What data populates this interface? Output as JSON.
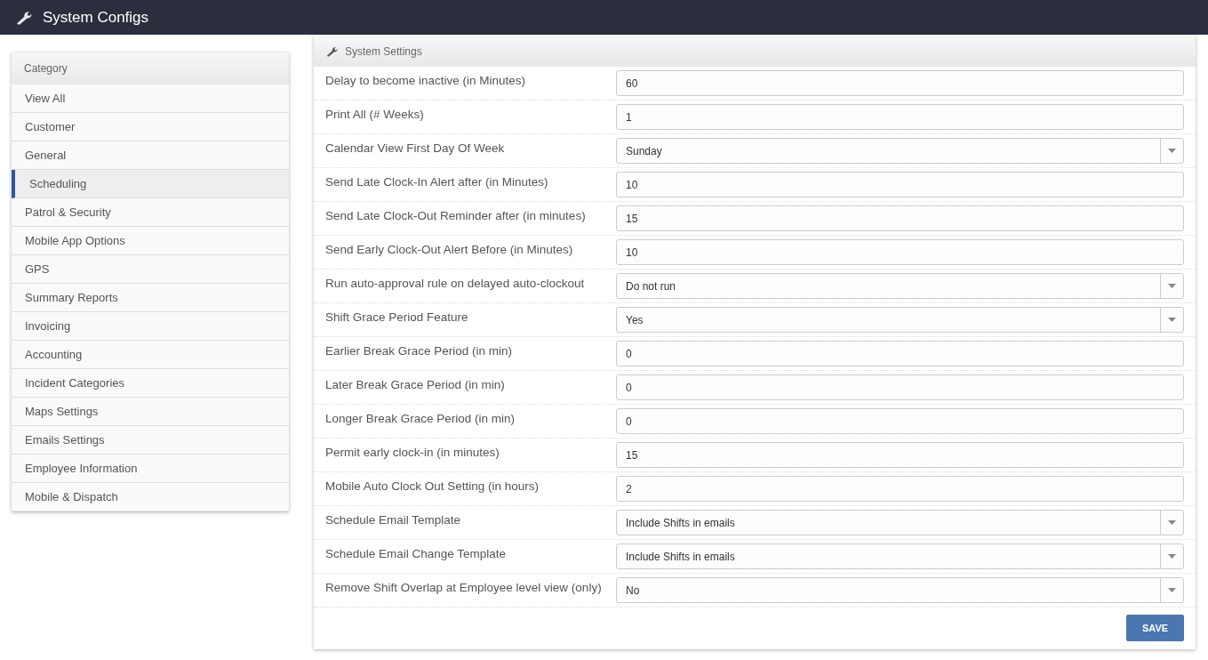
{
  "header": {
    "title": "System Configs"
  },
  "sidebar": {
    "heading": "Category",
    "items": [
      {
        "label": "View All",
        "selected": false
      },
      {
        "label": "Customer",
        "selected": false
      },
      {
        "label": "General",
        "selected": false
      },
      {
        "label": "Scheduling",
        "selected": true
      },
      {
        "label": "Patrol & Security",
        "selected": false
      },
      {
        "label": "Mobile App Options",
        "selected": false
      },
      {
        "label": "GPS",
        "selected": false
      },
      {
        "label": "Summary Reports",
        "selected": false
      },
      {
        "label": "Invoicing",
        "selected": false
      },
      {
        "label": "Accounting",
        "selected": false
      },
      {
        "label": "Incident Categories",
        "selected": false
      },
      {
        "label": "Maps Settings",
        "selected": false
      },
      {
        "label": "Emails Settings",
        "selected": false
      },
      {
        "label": "Employee Information",
        "selected": false
      },
      {
        "label": "Mobile & Dispatch",
        "selected": false
      }
    ]
  },
  "panel": {
    "title": "System Settings",
    "settings": [
      {
        "label": "Delay to become inactive (in Minutes)",
        "kind": "text",
        "value": "60"
      },
      {
        "label": "Print All (# Weeks)",
        "kind": "text",
        "value": "1"
      },
      {
        "label": "Calendar View First Day Of Week",
        "kind": "select",
        "value": "Sunday"
      },
      {
        "label": "Send Late Clock-In Alert after (in Minutes)",
        "kind": "text",
        "value": "10"
      },
      {
        "label": "Send Late Clock-Out Reminder after (in minutes)",
        "kind": "text",
        "value": "15"
      },
      {
        "label": "Send Early Clock-Out Alert Before (in Minutes)",
        "kind": "text",
        "value": "10"
      },
      {
        "label": "Run auto-approval rule on delayed auto-clockout",
        "kind": "select",
        "value": "Do not run"
      },
      {
        "label": "Shift Grace Period Feature",
        "kind": "select",
        "value": "Yes"
      },
      {
        "label": "Earlier Break Grace Period (in min)",
        "kind": "text",
        "value": "0"
      },
      {
        "label": "Later Break Grace Period (in min)",
        "kind": "text",
        "value": "0"
      },
      {
        "label": "Longer Break Grace Period (in min)",
        "kind": "text",
        "value": "0"
      },
      {
        "label": "Permit early clock-in (in minutes)",
        "kind": "text",
        "value": "15"
      },
      {
        "label": "Mobile Auto Clock Out Setting (in hours)",
        "kind": "text",
        "value": "2"
      },
      {
        "label": "Schedule Email Template",
        "kind": "select",
        "value": "Include Shifts in emails"
      },
      {
        "label": "Schedule Email Change Template",
        "kind": "select",
        "value": "Include Shifts in emails"
      },
      {
        "label": "Remove Shift Overlap at Employee level view (only)",
        "kind": "select",
        "value": "No"
      }
    ],
    "save_button": "SAVE"
  }
}
